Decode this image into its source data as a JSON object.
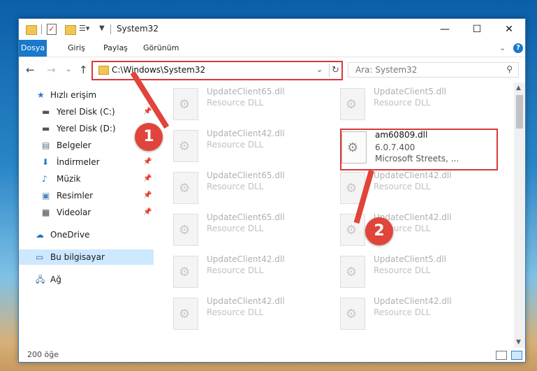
{
  "title": "System32",
  "ribbon_tabs": [
    "Dosya",
    "Giriş",
    "Paylaş",
    "Görünüm"
  ],
  "address_path": "C:\\Windows\\System32",
  "search_placeholder": "Ara: System32",
  "sidebar": [
    {
      "label": "Hızlı erişim",
      "icon": "star-icon",
      "pinned": false
    },
    {
      "label": "Yerel Disk (C:)",
      "icon": "drive-icon",
      "pinned": true
    },
    {
      "label": "Yerel Disk (D:)",
      "icon": "drive-icon",
      "pinned": true
    },
    {
      "label": "Belgeler",
      "icon": "document-icon",
      "pinned": false
    },
    {
      "label": "İndirmeler",
      "icon": "download-icon",
      "pinned": true
    },
    {
      "label": "Müzik",
      "icon": "music-icon",
      "pinned": true
    },
    {
      "label": "Resimler",
      "icon": "pictures-icon",
      "pinned": true
    },
    {
      "label": "Videolar",
      "icon": "video-icon",
      "pinned": true
    },
    {
      "label": "OneDrive",
      "icon": "cloud-icon",
      "pinned": false
    },
    {
      "label": "Bu bilgisayar",
      "icon": "computer-icon",
      "pinned": false
    },
    {
      "label": "Ağ",
      "icon": "network-icon",
      "pinned": false
    }
  ],
  "files": [
    {
      "name": "UpdateClient65.dll",
      "type": "Resource DLL"
    },
    {
      "name": "UpdateClient5.dll",
      "type": "Resource DLL"
    },
    {
      "name": "UpdateClient42.dll",
      "type": "Resource DLL"
    },
    {
      "name": "UpdateClient65.dll",
      "type": "Resource DLL"
    },
    {
      "name": "UpdateClient42.dll",
      "type": "Resource DLL"
    },
    {
      "name": "UpdateClient42.dll",
      "type": "Resource DLL"
    },
    {
      "name": "UpdateClient65.dll",
      "type": "Resource DLL"
    },
    {
      "name": "UpdateClient42.dll",
      "type": "Resource DLL"
    },
    {
      "name": "UpdateClient42.dll",
      "type": "Resource DLL"
    },
    {
      "name": "UpdateClient5.dll",
      "type": "Resource DLL"
    },
    {
      "name": "UpdateClient42.dll",
      "type": "Resource DLL"
    },
    {
      "name": "UpdateClient42.dll",
      "type": "Resource DLL"
    }
  ],
  "highlighted_file": {
    "name": "am60809.dll",
    "version": "6.0.7.400",
    "description": "Microsoft Streets, ..."
  },
  "status_count": "200 öğe",
  "step_badges": [
    "1",
    "2"
  ],
  "colors": {
    "accent": "#1979ca",
    "highlight_red": "#d9373a",
    "selected_bg": "#cde8ff"
  }
}
